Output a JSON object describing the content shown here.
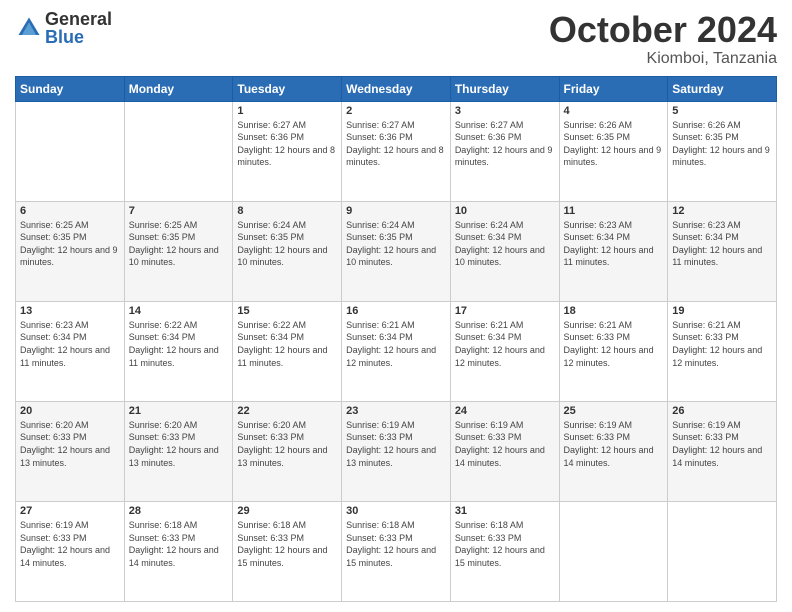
{
  "header": {
    "logo_general": "General",
    "logo_blue": "Blue",
    "month_title": "October 2024",
    "location": "Kiomboi, Tanzania"
  },
  "weekdays": [
    "Sunday",
    "Monday",
    "Tuesday",
    "Wednesday",
    "Thursday",
    "Friday",
    "Saturday"
  ],
  "weeks": [
    [
      {
        "day": "",
        "info": ""
      },
      {
        "day": "",
        "info": ""
      },
      {
        "day": "1",
        "info": "Sunrise: 6:27 AM\nSunset: 6:36 PM\nDaylight: 12 hours and 8 minutes."
      },
      {
        "day": "2",
        "info": "Sunrise: 6:27 AM\nSunset: 6:36 PM\nDaylight: 12 hours and 8 minutes."
      },
      {
        "day": "3",
        "info": "Sunrise: 6:27 AM\nSunset: 6:36 PM\nDaylight: 12 hours and 9 minutes."
      },
      {
        "day": "4",
        "info": "Sunrise: 6:26 AM\nSunset: 6:35 PM\nDaylight: 12 hours and 9 minutes."
      },
      {
        "day": "5",
        "info": "Sunrise: 6:26 AM\nSunset: 6:35 PM\nDaylight: 12 hours and 9 minutes."
      }
    ],
    [
      {
        "day": "6",
        "info": "Sunrise: 6:25 AM\nSunset: 6:35 PM\nDaylight: 12 hours and 9 minutes."
      },
      {
        "day": "7",
        "info": "Sunrise: 6:25 AM\nSunset: 6:35 PM\nDaylight: 12 hours and 10 minutes."
      },
      {
        "day": "8",
        "info": "Sunrise: 6:24 AM\nSunset: 6:35 PM\nDaylight: 12 hours and 10 minutes."
      },
      {
        "day": "9",
        "info": "Sunrise: 6:24 AM\nSunset: 6:35 PM\nDaylight: 12 hours and 10 minutes."
      },
      {
        "day": "10",
        "info": "Sunrise: 6:24 AM\nSunset: 6:34 PM\nDaylight: 12 hours and 10 minutes."
      },
      {
        "day": "11",
        "info": "Sunrise: 6:23 AM\nSunset: 6:34 PM\nDaylight: 12 hours and 11 minutes."
      },
      {
        "day": "12",
        "info": "Sunrise: 6:23 AM\nSunset: 6:34 PM\nDaylight: 12 hours and 11 minutes."
      }
    ],
    [
      {
        "day": "13",
        "info": "Sunrise: 6:23 AM\nSunset: 6:34 PM\nDaylight: 12 hours and 11 minutes."
      },
      {
        "day": "14",
        "info": "Sunrise: 6:22 AM\nSunset: 6:34 PM\nDaylight: 12 hours and 11 minutes."
      },
      {
        "day": "15",
        "info": "Sunrise: 6:22 AM\nSunset: 6:34 PM\nDaylight: 12 hours and 11 minutes."
      },
      {
        "day": "16",
        "info": "Sunrise: 6:21 AM\nSunset: 6:34 PM\nDaylight: 12 hours and 12 minutes."
      },
      {
        "day": "17",
        "info": "Sunrise: 6:21 AM\nSunset: 6:34 PM\nDaylight: 12 hours and 12 minutes."
      },
      {
        "day": "18",
        "info": "Sunrise: 6:21 AM\nSunset: 6:33 PM\nDaylight: 12 hours and 12 minutes."
      },
      {
        "day": "19",
        "info": "Sunrise: 6:21 AM\nSunset: 6:33 PM\nDaylight: 12 hours and 12 minutes."
      }
    ],
    [
      {
        "day": "20",
        "info": "Sunrise: 6:20 AM\nSunset: 6:33 PM\nDaylight: 12 hours and 13 minutes."
      },
      {
        "day": "21",
        "info": "Sunrise: 6:20 AM\nSunset: 6:33 PM\nDaylight: 12 hours and 13 minutes."
      },
      {
        "day": "22",
        "info": "Sunrise: 6:20 AM\nSunset: 6:33 PM\nDaylight: 12 hours and 13 minutes."
      },
      {
        "day": "23",
        "info": "Sunrise: 6:19 AM\nSunset: 6:33 PM\nDaylight: 12 hours and 13 minutes."
      },
      {
        "day": "24",
        "info": "Sunrise: 6:19 AM\nSunset: 6:33 PM\nDaylight: 12 hours and 14 minutes."
      },
      {
        "day": "25",
        "info": "Sunrise: 6:19 AM\nSunset: 6:33 PM\nDaylight: 12 hours and 14 minutes."
      },
      {
        "day": "26",
        "info": "Sunrise: 6:19 AM\nSunset: 6:33 PM\nDaylight: 12 hours and 14 minutes."
      }
    ],
    [
      {
        "day": "27",
        "info": "Sunrise: 6:19 AM\nSunset: 6:33 PM\nDaylight: 12 hours and 14 minutes."
      },
      {
        "day": "28",
        "info": "Sunrise: 6:18 AM\nSunset: 6:33 PM\nDaylight: 12 hours and 14 minutes."
      },
      {
        "day": "29",
        "info": "Sunrise: 6:18 AM\nSunset: 6:33 PM\nDaylight: 12 hours and 15 minutes."
      },
      {
        "day": "30",
        "info": "Sunrise: 6:18 AM\nSunset: 6:33 PM\nDaylight: 12 hours and 15 minutes."
      },
      {
        "day": "31",
        "info": "Sunrise: 6:18 AM\nSunset: 6:33 PM\nDaylight: 12 hours and 15 minutes."
      },
      {
        "day": "",
        "info": ""
      },
      {
        "day": "",
        "info": ""
      }
    ]
  ]
}
